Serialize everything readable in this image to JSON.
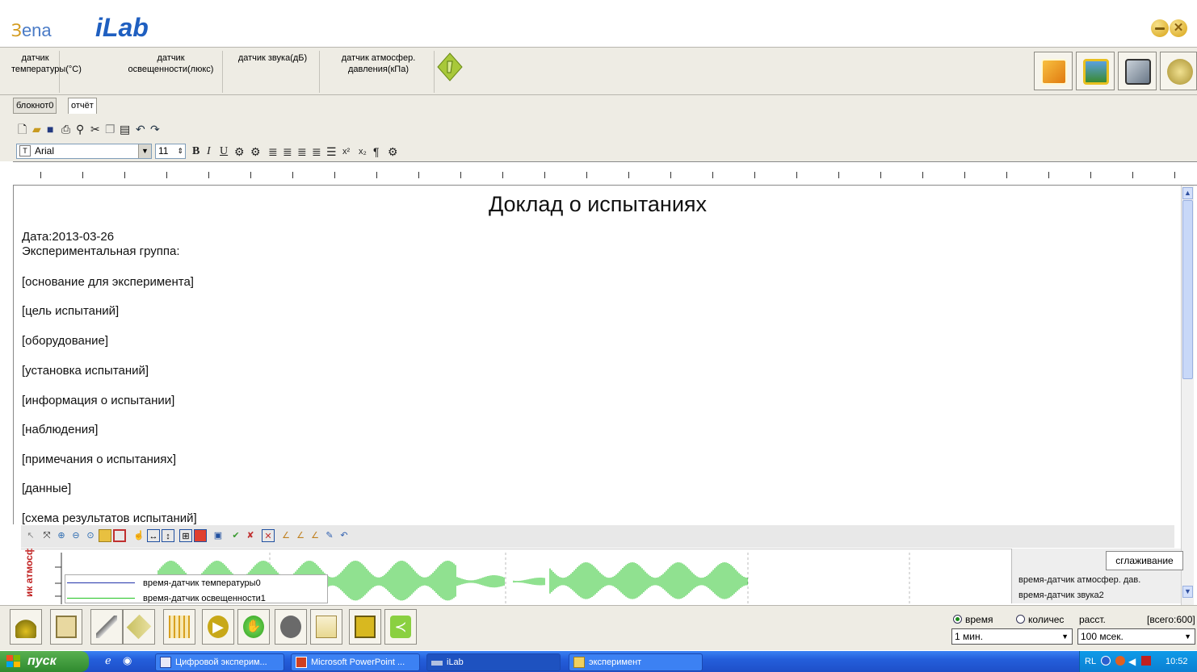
{
  "app": {
    "brand_left_b": "Ɜ",
    "brand_left_rest": "ena",
    "brand_name": "iLab",
    "close_glyph": "✕"
  },
  "sensors": [
    {
      "label": "датчик температуры(°С)"
    },
    {
      "label": "датчик освещенности(люкс)"
    },
    {
      "label": "датчик звука(дБ)"
    },
    {
      "label": "датчик атмосфер. давления(кПа)"
    }
  ],
  "tabs": [
    {
      "label": "блокнот0"
    },
    {
      "label": "отчёт"
    }
  ],
  "format": {
    "font": "Arial",
    "size": "11"
  },
  "document": {
    "title": "Доклад о испытаниях",
    "date": "Дата:2013-03-26",
    "group": "Экспериментальная группа:",
    "sections": [
      "[основание для эксперимента]",
      "[цель испытаний]",
      "[оборудование]",
      "[установка испытаний]",
      "[информация о испытании]",
      "[наблюдения]",
      "[примечания о испытаниях]",
      "[данные]",
      "[схема результатов испытаний]"
    ]
  },
  "chart": {
    "y_axis_label": "ик атмосф",
    "legend_left": [
      "время-датчик температуры0",
      "время-датчик освещенности1"
    ],
    "legend_right": [
      "время-датчик атмосфер. дав.",
      "время-датчик звука2"
    ],
    "smoothing_button": "сглаживание",
    "colors": {
      "series_green": "#22c322",
      "series_blue": "#2233aa"
    }
  },
  "controls": {
    "radio_time": "время",
    "radio_count": "количес",
    "distance_label": "расст.",
    "total": "[всего:600]",
    "time_value": "1 мин.",
    "interval_value": "100 мсек."
  },
  "taskbar": {
    "start": "пуск",
    "tasks": [
      "Цифровой эксперим...",
      "Microsoft PowerPoint ...",
      "iLab",
      "эксперимент"
    ],
    "lang": "RL",
    "clock": "10:52"
  }
}
